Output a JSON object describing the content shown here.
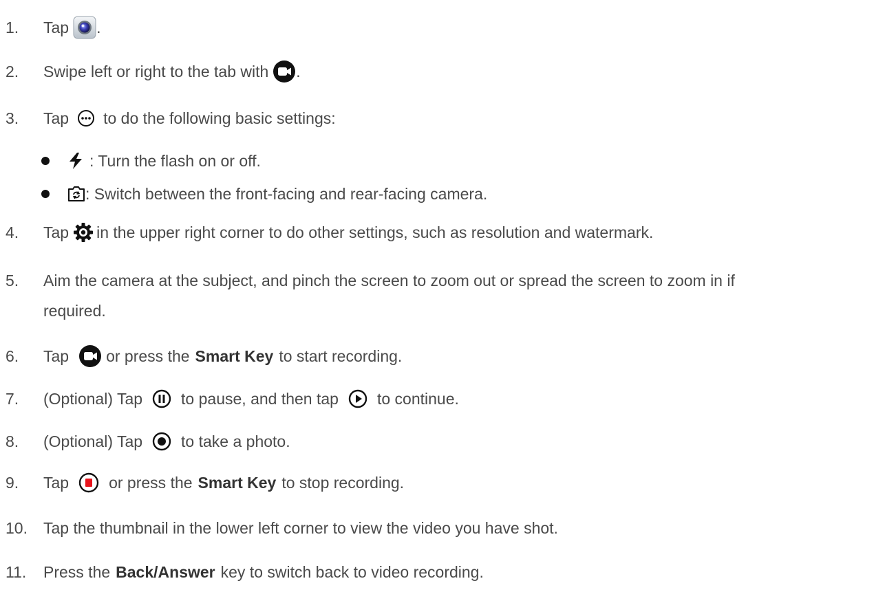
{
  "steps": {
    "s1": {
      "num": "1.",
      "pre": "Tap",
      "post": "."
    },
    "s2": {
      "num": "2.",
      "pre": "Swipe left or right to the tab with",
      "post": "."
    },
    "s3": {
      "num": "3.",
      "pre": "Tap",
      "post": "to do the following basic settings:"
    },
    "b1": {
      "post": ": Turn the flash on or off."
    },
    "b2": {
      "post": ": Switch between the front-facing and rear-facing camera."
    },
    "s4": {
      "num": "4.",
      "pre": "Tap",
      "post": "in the upper right corner to do other settings, such as resolution and watermark."
    },
    "s5": {
      "num": "5.",
      "line1": "Aim the camera at the subject, and pinch the screen to zoom out or spread the screen to zoom in if",
      "line2": "required."
    },
    "s6": {
      "num": "6.",
      "pre": "Tap",
      "mid": "or press the",
      "bold": "Smart Key",
      "post": "to start recording."
    },
    "s7": {
      "num": "7.",
      "pre": "(Optional) Tap",
      "mid": "to pause, and then tap",
      "post": "to continue."
    },
    "s8": {
      "num": "8.",
      "pre": "(Optional) Tap",
      "post": "to take a photo."
    },
    "s9": {
      "num": "9.",
      "pre": "Tap",
      "mid": "or press the",
      "bold": "Smart Key",
      "post": "to stop recording."
    },
    "s10": {
      "num": "10.",
      "text": "Tap the thumbnail in the lower left corner to view the video you have shot."
    },
    "s11": {
      "num": "11.",
      "pre": "Press the",
      "bold": "Back/Answer",
      "post": "key to switch back to video recording."
    }
  },
  "icons": {
    "camera_app": "camera-app-icon",
    "video_tab": "video-camera-icon",
    "more": "more-options-icon",
    "flash": "flash-icon",
    "switch_camera": "switch-camera-icon",
    "settings": "settings-gear-icon",
    "record": "record-video-icon",
    "pause": "pause-icon",
    "play": "play-icon",
    "photo": "capture-photo-icon",
    "stop": "stop-recording-icon"
  },
  "colors": {
    "stop_red": "#e8141c",
    "camera_blue": "#3b3fb5"
  }
}
